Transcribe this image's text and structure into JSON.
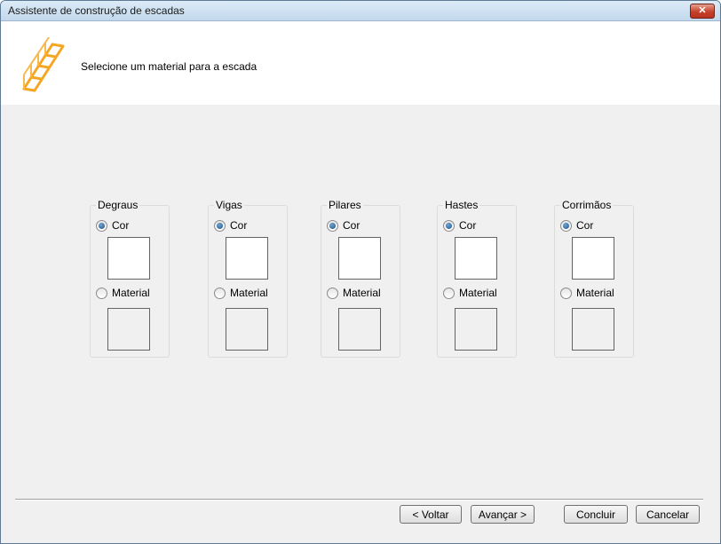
{
  "window": {
    "title": "Assistente de construção de escadas",
    "close_glyph": "✕"
  },
  "header": {
    "instruction": "Selecione um material para a escada",
    "icon": "stair-icon"
  },
  "groups": [
    {
      "label": "Degraus",
      "color_option": "Cor",
      "material_option": "Material",
      "selected": "color",
      "color_value": "#ffffff"
    },
    {
      "label": "Vigas",
      "color_option": "Cor",
      "material_option": "Material",
      "selected": "color",
      "color_value": "#ffffff"
    },
    {
      "label": "Pilares",
      "color_option": "Cor",
      "material_option": "Material",
      "selected": "color",
      "color_value": "#ffffff"
    },
    {
      "label": "Hastes",
      "color_option": "Cor",
      "material_option": "Material",
      "selected": "color",
      "color_value": "#ffffff"
    },
    {
      "label": "Corrimãos",
      "color_option": "Cor",
      "material_option": "Material",
      "selected": "color",
      "color_value": "#ffffff"
    }
  ],
  "buttons": {
    "back": "< Voltar",
    "next": "Avançar >",
    "finish": "Concluir",
    "cancel": "Cancelar"
  },
  "colors": {
    "icon_accent": "#f5a623",
    "radio_selected": "#1d4f80"
  }
}
